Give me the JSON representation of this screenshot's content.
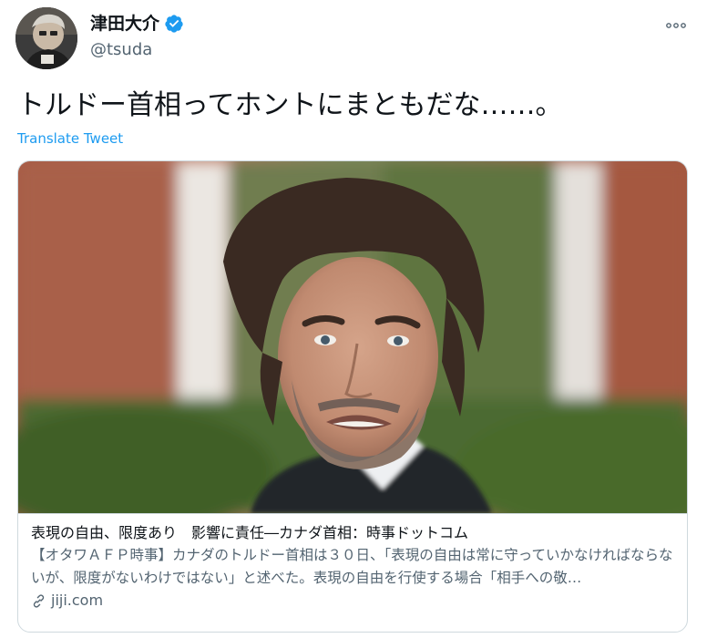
{
  "author": {
    "name": "津田大介",
    "handle": "@tsuda",
    "verified": true
  },
  "tweet": {
    "text": "トルドー首相ってホントにまともだな……。",
    "translate_label": "Translate Tweet"
  },
  "card": {
    "title": "表現の自由、限度あり　影響に責任―カナダ首相：時事ドットコム",
    "description": "【オタワＡＦＰ時事】カナダのトルドー首相は３０日、「表現の自由は常に守っていかなければならないが、限度がないわけではない」と述べた。表現の自由を行使する場合「相手への敬…",
    "domain": "jiji.com"
  },
  "icons": {
    "verified": "verified-badge-icon",
    "more": "more-options-icon",
    "link": "link-icon"
  },
  "colors": {
    "accent": "#1d9bf0",
    "text": "#0f1419",
    "secondary": "#536471",
    "border": "#cfd9de"
  }
}
